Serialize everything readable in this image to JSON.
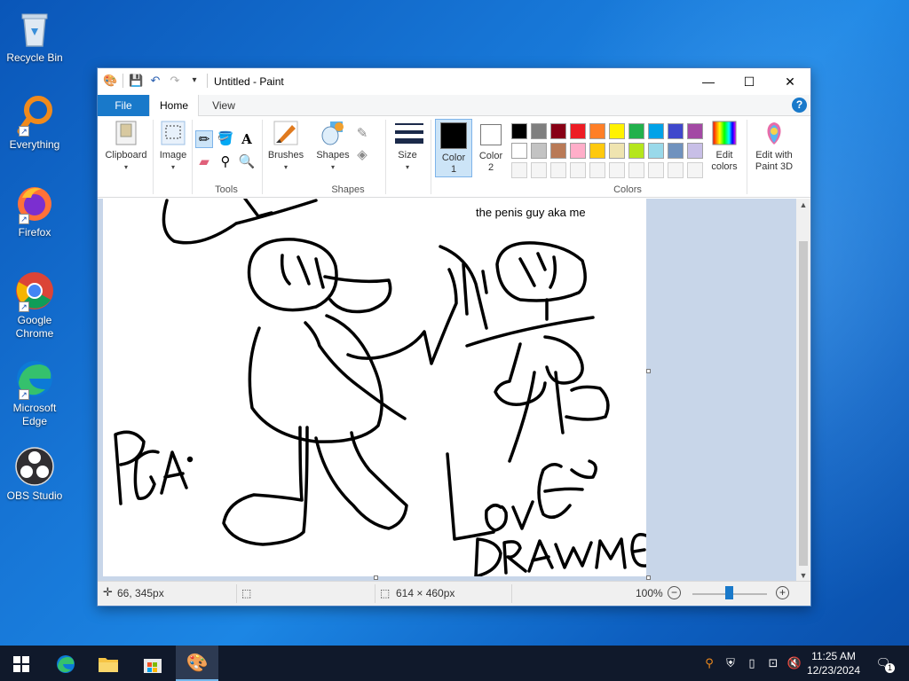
{
  "desktop": {
    "icons": [
      {
        "label": "Recycle Bin"
      },
      {
        "label": "Everything"
      },
      {
        "label": "Firefox"
      },
      {
        "label": "Google Chrome"
      },
      {
        "label": "Microsoft Edge"
      },
      {
        "label": "OBS Studio"
      }
    ]
  },
  "window": {
    "title": "Untitled - Paint",
    "tabs": {
      "file": "File",
      "home": "Home",
      "view": "View"
    },
    "ribbon": {
      "clipboard": "Clipboard",
      "image": "Image",
      "tools": "Tools",
      "brushes": "Brushes",
      "shapes_btn": "Shapes",
      "shapes_group": "Shapes",
      "size": "Size",
      "color1_line1": "Color",
      "color1_line2": "1",
      "color2_line1": "Color",
      "color2_line2": "2",
      "edit_colors_line1": "Edit",
      "edit_colors_line2": "colors",
      "colors_group": "Colors",
      "edit3d_line1": "Edit with",
      "edit3d_line2": "Paint 3D"
    },
    "palette_row1": [
      "#000000",
      "#7f7f7f",
      "#880015",
      "#ed1c24",
      "#ff7f27",
      "#fff200",
      "#22b14c",
      "#00a2e8",
      "#3f48cc",
      "#a349a4"
    ],
    "palette_row2": [
      "#ffffff",
      "#c3c3c3",
      "#b97a57",
      "#ffaec9",
      "#ffc90e",
      "#efe4b0",
      "#b5e61d",
      "#99d9ea",
      "#7092be",
      "#c8bfe7"
    ],
    "canvas": {
      "caption": "the penis guy aka me"
    },
    "status": {
      "cursor_pos": "66, 345px",
      "canvas_size": "614 × 460px",
      "zoom": "100%"
    }
  },
  "taskbar": {
    "time": "11:25 AM",
    "date": "12/23/2024",
    "notification_count": "1"
  }
}
